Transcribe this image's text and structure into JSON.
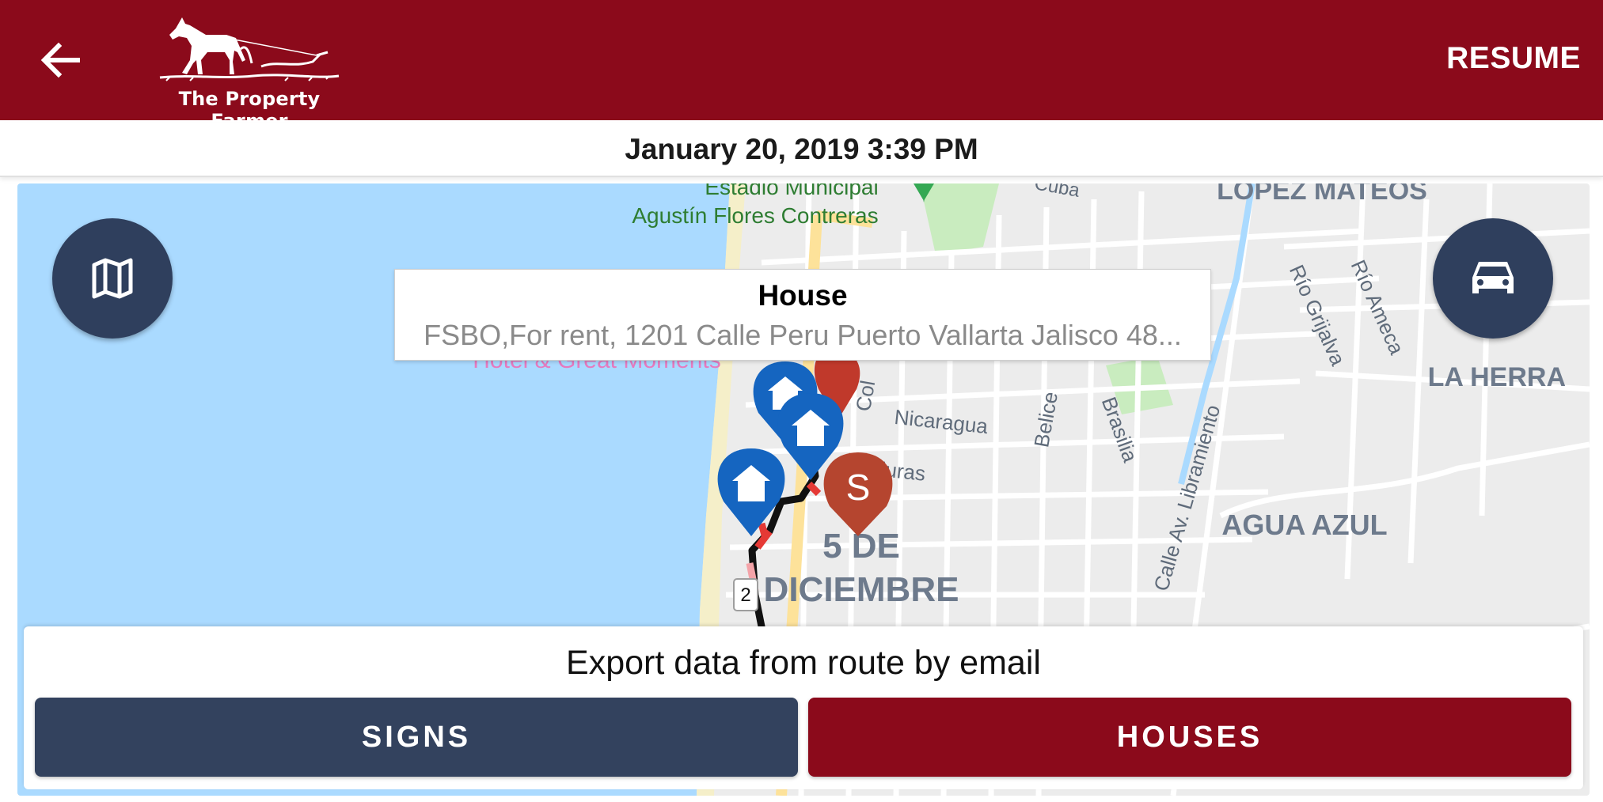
{
  "header": {
    "logo_text": "The Property Farmer",
    "resume_label": "RESUME",
    "back_icon": "arrow-left-icon",
    "brand_color": "#8b0a1b"
  },
  "date_bar": {
    "datetime": "January 20, 2019 3:39 PM"
  },
  "map": {
    "labels": {
      "stadium_1": "Estadio Municipal",
      "stadium_2": "Agustín Flores Contreras",
      "hotel": "Hotel & Great Moments",
      "lopez_mateos": "LÓPEZ MATEOS",
      "la_herra": "LA HERRA",
      "agua_azul": "AGUA AZUL",
      "five_de": "5 DE",
      "diciembre": "DICIEMBRE",
      "nicaragua": "Nicaragua",
      "honduras": "Honduras",
      "belice": "Belice",
      "brasilia": "Brasilia",
      "libramiento": "Calle Av. Libramiento",
      "rio_grijalva": "Río Grijalva",
      "rio_ameca": "Río Ameca",
      "cuba": "Cuba",
      "col": "Col"
    },
    "route_marker_label": "2",
    "sign_marker_letter": "S",
    "map_toggle_icon": "map-icon",
    "car_icon": "car-icon"
  },
  "info_window": {
    "title": "House",
    "subtitle": "FSBO,For rent, 1201 Calle Peru Puerto Vallarta Jalisco 48..."
  },
  "export": {
    "title": "Export data from route by email",
    "signs_label": "SIGNS",
    "houses_label": "HOUSES",
    "signs_color": "#33425e",
    "houses_color": "#8b0a1b"
  }
}
